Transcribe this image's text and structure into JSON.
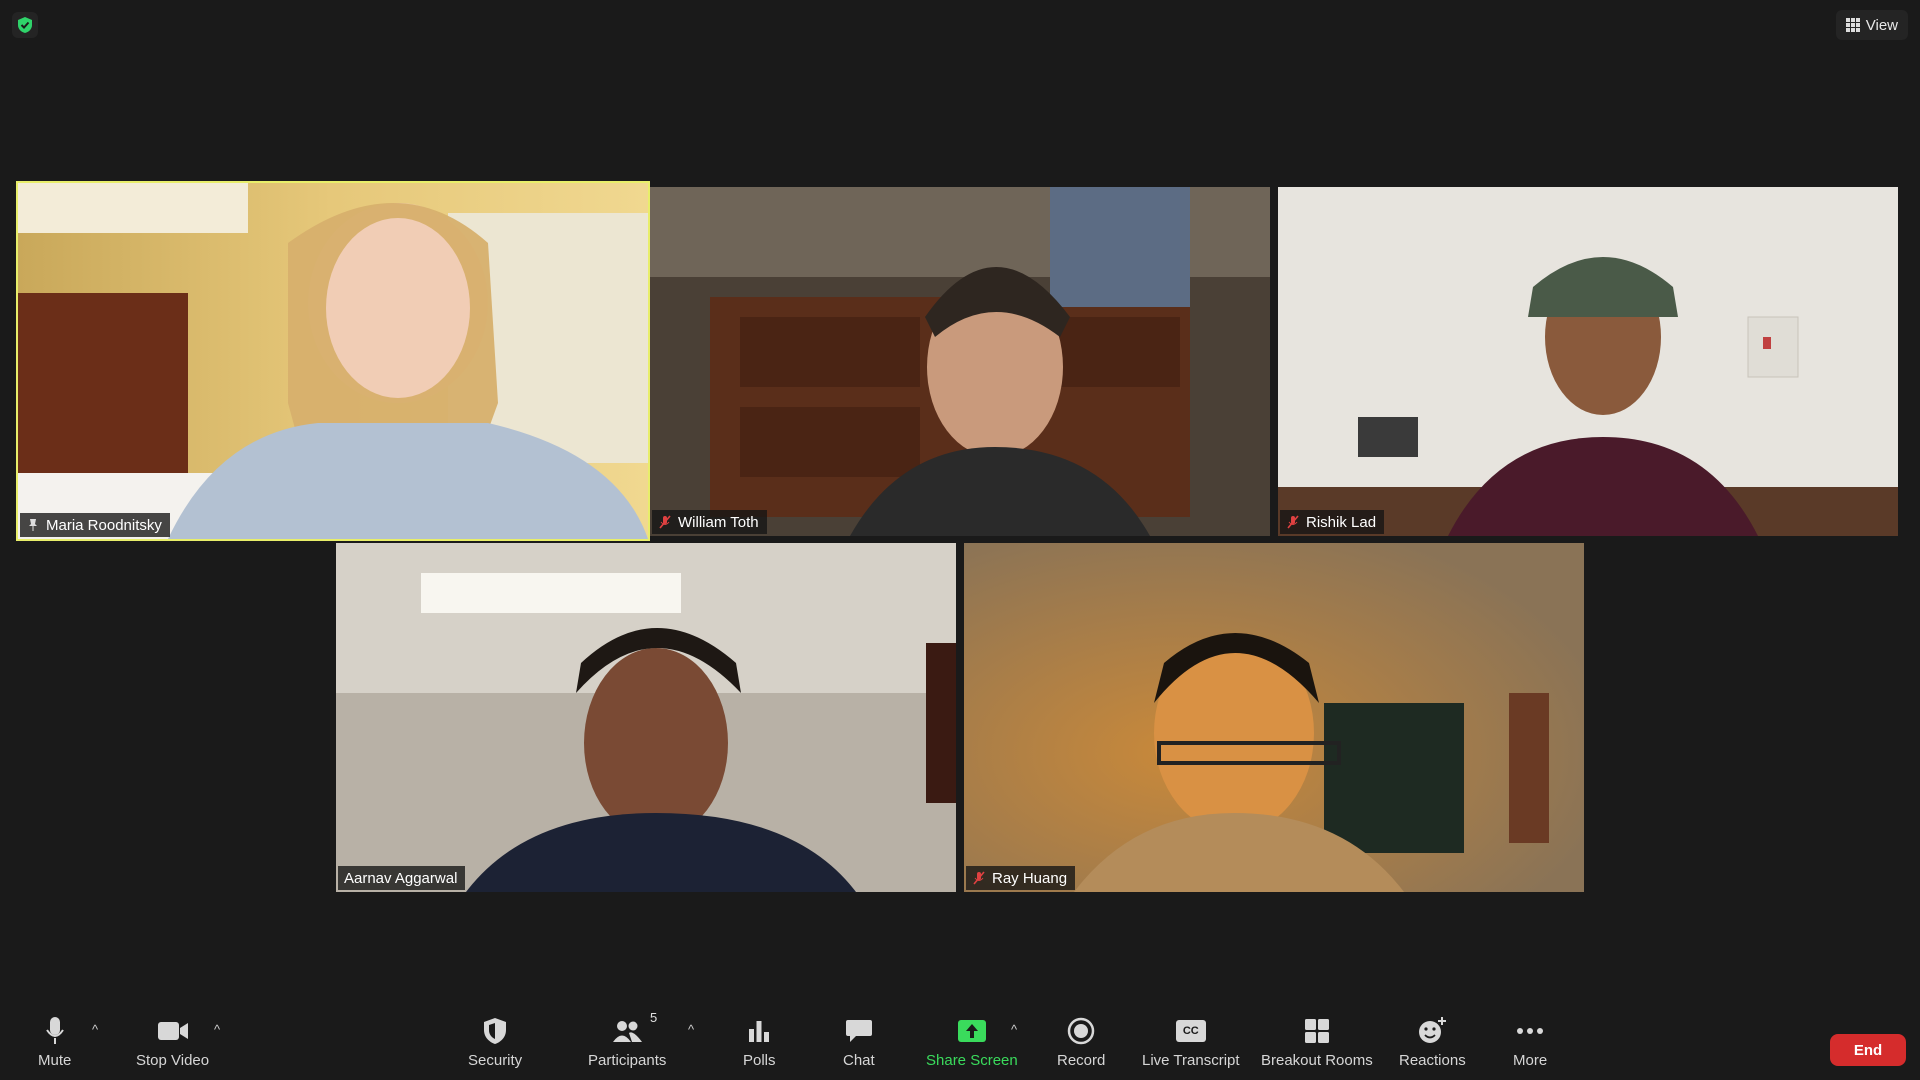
{
  "header": {
    "view_label": "View",
    "security_badge_icon": "shield-check-icon",
    "accent_green": "#2fd36a"
  },
  "participants": [
    {
      "name": "Maria Roodnitsky",
      "status_icon": "pin-icon",
      "active_speaker": true
    },
    {
      "name": "William Toth",
      "status_icon": "mic-muted-icon",
      "active_speaker": false
    },
    {
      "name": "Rishik Lad",
      "status_icon": "mic-muted-icon",
      "active_speaker": false
    },
    {
      "name": "Aarnav Aggarwal",
      "status_icon": "",
      "active_speaker": false
    },
    {
      "name": "Ray Huang",
      "status_icon": "mic-muted-icon",
      "active_speaker": false
    }
  ],
  "toolbar": {
    "mute": "Mute",
    "stop_video": "Stop Video",
    "security": "Security",
    "participants": "Participants",
    "participants_count": "5",
    "polls": "Polls",
    "chat": "Chat",
    "share_screen": "Share Screen",
    "record": "Record",
    "live_transcript": "Live Transcript",
    "breakout_rooms": "Breakout Rooms",
    "reactions": "Reactions",
    "more": "More",
    "end": "End",
    "caret": "^",
    "cc": "CC"
  },
  "colors": {
    "active_speaker_border": "#e8ee6a",
    "end_button": "#d52c2c",
    "share_screen": "#3adb5c"
  }
}
